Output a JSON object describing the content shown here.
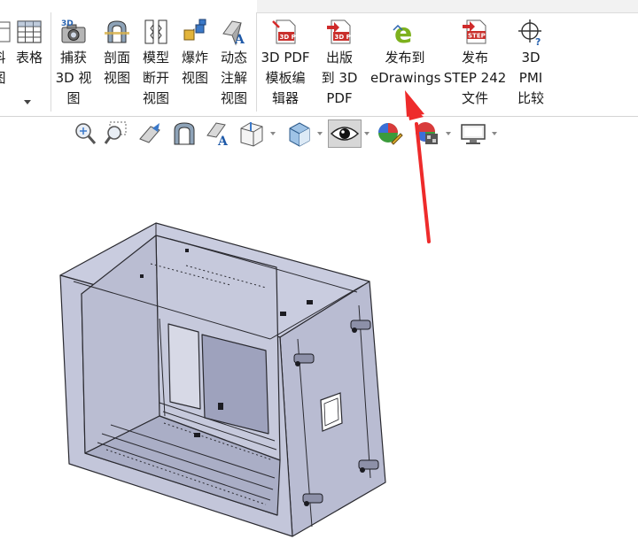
{
  "ribbon": {
    "items": [
      {
        "id": "partial1",
        "label": "料\n图"
      },
      {
        "id": "table",
        "label": "表格"
      },
      {
        "id": "capture3d",
        "label": "捕获\n3D 视\n图"
      },
      {
        "id": "section",
        "label": "剖面\n视图"
      },
      {
        "id": "model_break",
        "label": "模型\n断开\n视图"
      },
      {
        "id": "explode",
        "label": "爆炸\n视图"
      },
      {
        "id": "animated_annot",
        "label": "动态\n注解\n视图"
      },
      {
        "id": "pdf_template",
        "label": "3D PDF\n模板编\n辑器"
      },
      {
        "id": "publish_pdf",
        "label": "出版\n到 3D\nPDF"
      },
      {
        "id": "publish_edrawings",
        "label": "发布到\neDrawings"
      },
      {
        "id": "publish_step",
        "label": "发布\nSTEP 242\n文件"
      },
      {
        "id": "pmi_compare",
        "label": "3D\nPMI\n比较"
      }
    ],
    "icon_labels": {
      "pdf": "3D PDF",
      "step": "STEP",
      "capture": "3D"
    }
  },
  "colors": {
    "arrow": "#ee2b2b",
    "accent_green": "#7db11d",
    "model_fill": "#c4c7dc",
    "model_edge": "#2a2a30"
  }
}
